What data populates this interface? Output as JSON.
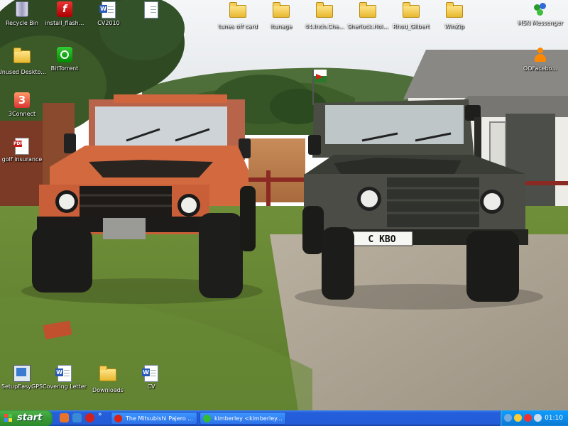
{
  "desktop": {
    "icons_left": [
      {
        "label": "Recycle Bin",
        "icon": "recycle-bin-icon"
      },
      {
        "label": "install_flash...",
        "icon": "flash-installer-icon"
      },
      {
        "label": "Unused Deskto...",
        "icon": "folder-icon"
      },
      {
        "label": "BitTorrent",
        "icon": "bittorrent-icon"
      },
      {
        "label": "3Connect",
        "icon": "3connect-icon"
      },
      {
        "label": "golf insurance",
        "icon": "pdf-icon"
      }
    ],
    "icons_top": [
      {
        "label": "CV2010",
        "icon": "word-document-icon"
      },
      {
        "label": "tunes off card",
        "icon": "folder-icon"
      },
      {
        "label": "itunage",
        "icon": "folder-icon"
      },
      {
        "label": "44.Inch.Che...",
        "icon": "folder-icon"
      },
      {
        "label": "Sherlock.Hol...",
        "icon": "folder-icon"
      },
      {
        "label": "Rhod_Gilbert",
        "icon": "folder-icon"
      },
      {
        "label": "WinZip",
        "icon": "folder-icon"
      }
    ],
    "icons_right": [
      {
        "label": "MSN Messenger",
        "icon": "msn-messenger-icon"
      },
      {
        "label": "OOFacebo...",
        "icon": "person-icon"
      }
    ],
    "icons_bottom": [
      {
        "label": "SetupEasyGPS",
        "icon": "gps-setup-icon"
      },
      {
        "label": "Covering Letter",
        "icon": "word-document-icon"
      },
      {
        "label": "Downloads",
        "icon": "folder-icon"
      },
      {
        "label": "CV",
        "icon": "word-document-icon"
      }
    ],
    "wallpaper": {
      "scene": "two-land-rover-defenders",
      "plate_right": "C  KBO"
    }
  },
  "taskbar": {
    "start_label": "start",
    "tasks": [
      {
        "label": "The Mitsubishi Pajero ...",
        "icon": "opera-icon",
        "active": false
      },
      {
        "label": "kimberley <kimberley....",
        "icon": "msn-chat-icon",
        "active": false
      }
    ],
    "clock": "01:10"
  },
  "colors": {
    "taskbar": "#245edb",
    "start_green": "#3a9a35",
    "tray": "#0d8dea"
  }
}
